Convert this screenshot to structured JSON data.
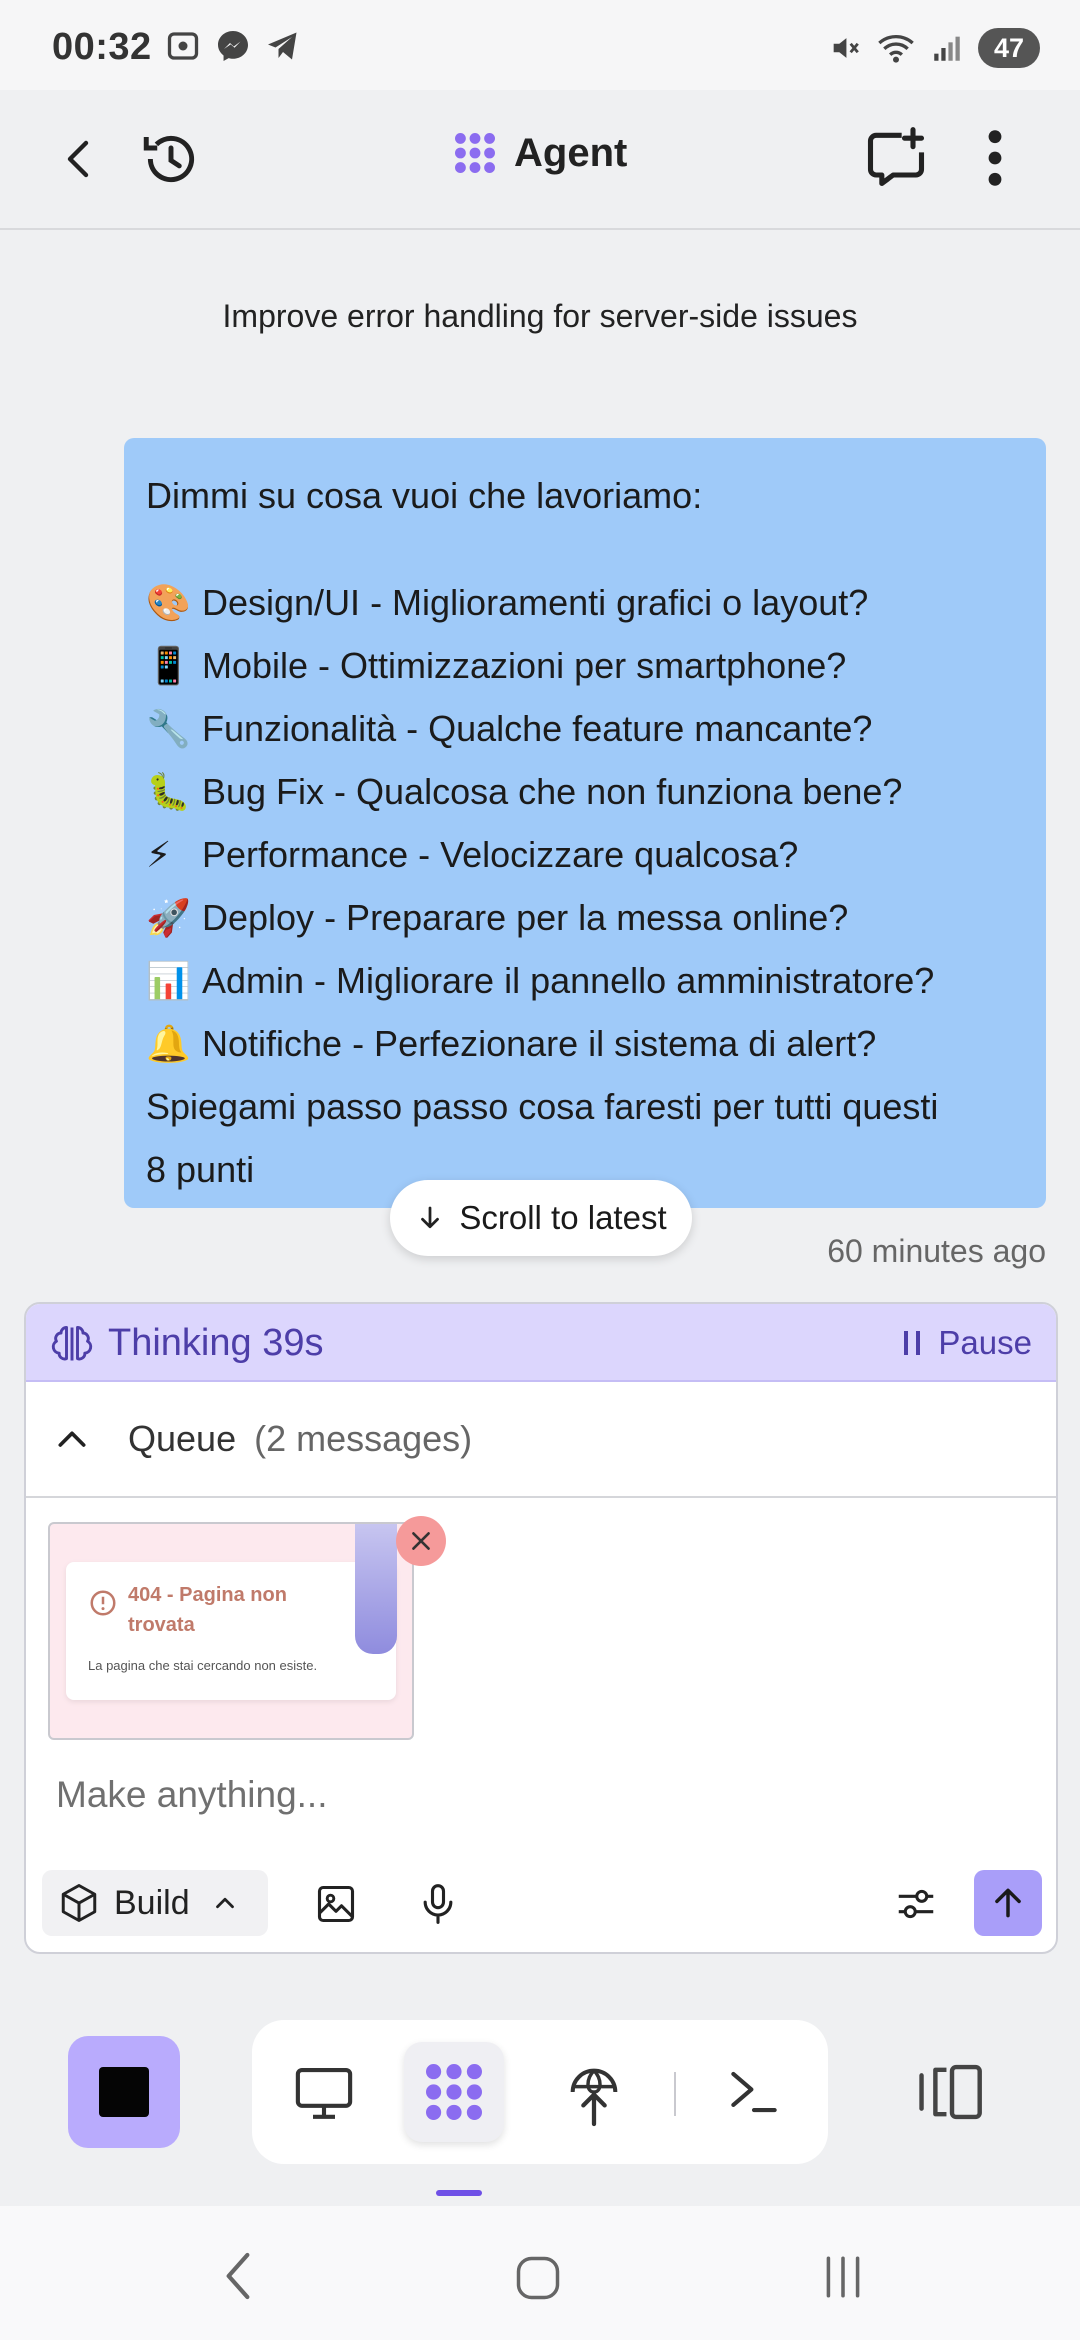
{
  "status_bar": {
    "time": "00:32",
    "battery": "47"
  },
  "header": {
    "title": "Agent"
  },
  "conversation": {
    "subtitle": "Improve error handling for server-side issues",
    "message": {
      "intro": "Dimmi su cosa vuoi che lavoriamo:",
      "items": [
        {
          "emoji": "🎨",
          "text": "Design/UI - Miglioramenti grafici o layout?"
        },
        {
          "emoji": "📱",
          "text": "Mobile - Ottimizzazioni per smartphone?"
        },
        {
          "emoji": "🔧",
          "text": "Funzionalità - Qualche feature mancante?"
        },
        {
          "emoji": "🐛",
          "text": "Bug Fix - Qualcosa che non funziona bene?"
        },
        {
          "emoji": "⚡",
          "text": "Performance - Velocizzare qualcosa?"
        },
        {
          "emoji": "🚀",
          "text": "Deploy - Preparare per la messa online?"
        },
        {
          "emoji": "📊",
          "text": "Admin - Migliorare il pannello amministratore?"
        },
        {
          "emoji": "🔔",
          "text": "Notifiche - Perfezionare il sistema di alert?"
        }
      ],
      "outro_1": "Spiegami passo passo cosa faresti per tutti questi",
      "outro_2": "8 punti"
    },
    "scroll_to_latest": "Scroll to latest",
    "timestamp": "60 minutes ago"
  },
  "composer": {
    "thinking_label": "Thinking 39s",
    "pause_label": "Pause",
    "queue_label": "Queue",
    "queue_count": "(2 messages)",
    "attachment": {
      "title": "404 - Pagina non trovata",
      "body": "La pagina che stai cercando non esiste."
    },
    "input_placeholder": "Make anything...",
    "build_label": "Build"
  },
  "colors": {
    "accent": "#a99ef9",
    "bubble": "#9fcaf9",
    "thinking_bg": "#dcd6fd",
    "thinking_text": "#4d3ea8"
  }
}
